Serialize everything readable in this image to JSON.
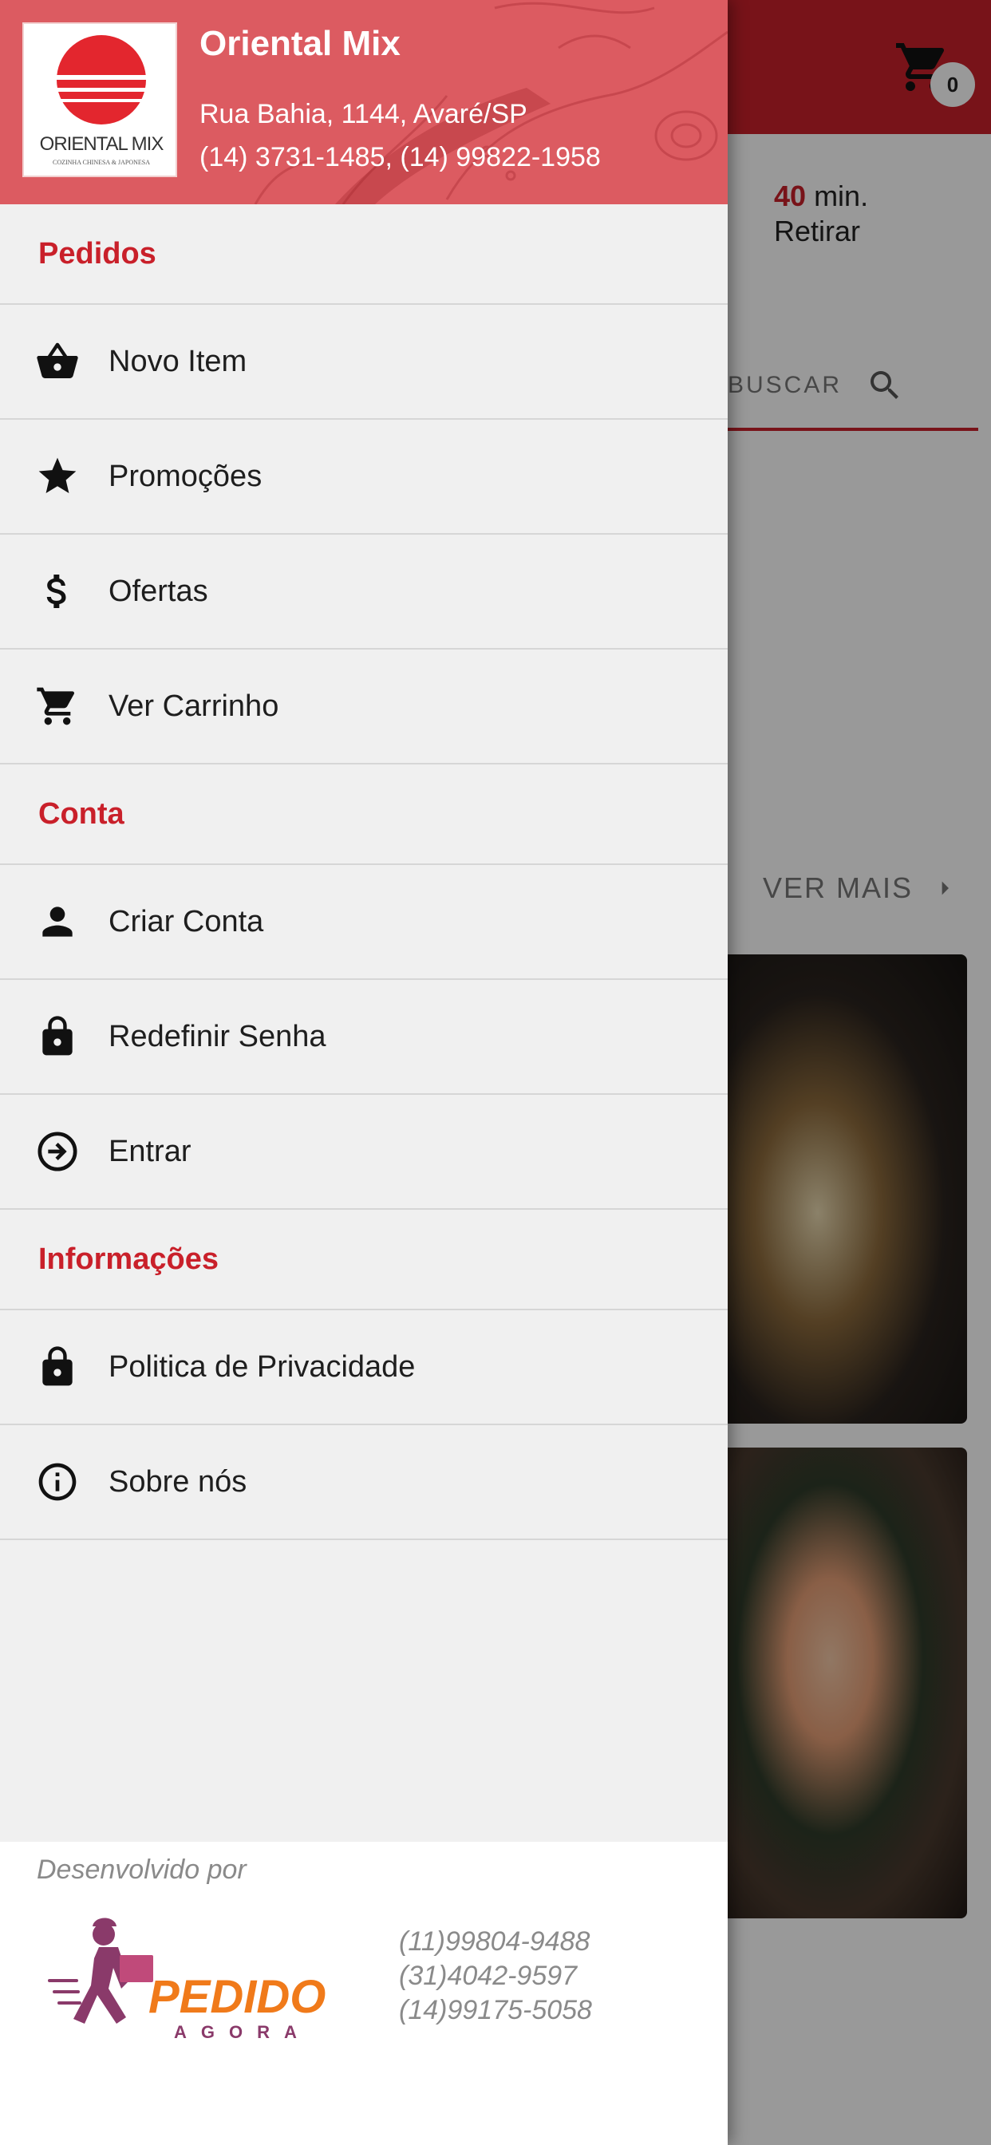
{
  "background": {
    "cart_count": "0",
    "time_value": "40",
    "time_unit": "min.",
    "delivery_mode": "Retirar",
    "search_label": "BUSCAR",
    "ver_mais_label": "VER MAIS"
  },
  "drawer": {
    "store": {
      "logo_text": "ORIENTAL MIX",
      "logo_subtext": "COZINHA CHINESA & JAPONESA",
      "name": "Oriental Mix",
      "address": "Rua Bahia, 1144, Avaré/SP",
      "phones": "(14) 3731-1485, (14) 99822-1958"
    },
    "sections": {
      "pedidos": "Pedidos",
      "conta": "Conta",
      "informacoes": "Informações"
    },
    "items": {
      "novo_item": "Novo Item",
      "promocoes": "Promoções",
      "ofertas": "Ofertas",
      "ver_carrinho": "Ver Carrinho",
      "criar_conta": "Criar Conta",
      "redefinir_senha": "Redefinir Senha",
      "entrar": "Entrar",
      "politica": "Politica de Privacidade",
      "sobre": "Sobre nós"
    },
    "footer": {
      "developed_by": "Desenvolvido por",
      "brand_main": "PEDIDO",
      "brand_sub": "AGORA",
      "phone_1": "(11)99804-9488",
      "phone_2": "(31)4042-9597",
      "phone_3": "(14)99175-5058"
    }
  },
  "colors": {
    "accent": "#c9202a",
    "header": "#dc5b61",
    "drawer_bg": "#f0f0f0",
    "brand_orange": "#f07a1a",
    "brand_purple": "#8a3a6a"
  }
}
